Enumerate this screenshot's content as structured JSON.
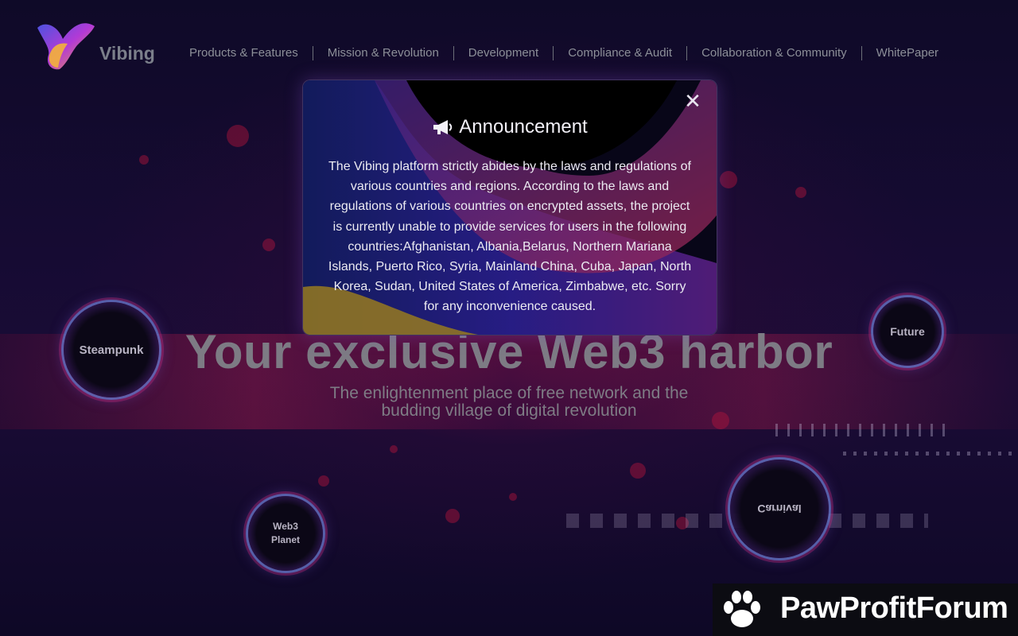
{
  "brand": {
    "name": "Vibing",
    "accent": "#7c3aed"
  },
  "nav": {
    "items": [
      {
        "label": "Products & Features"
      },
      {
        "label": "Mission & Revolution"
      },
      {
        "label": "Development"
      },
      {
        "label": "Compliance & Audit"
      },
      {
        "label": "Collaboration & Community"
      },
      {
        "label": "WhitePaper"
      }
    ]
  },
  "hero": {
    "title": "Your exclusive Web3 harbor",
    "subtitle": "The enlightenment place of free network and the budding village of digital revolution"
  },
  "orbs": [
    {
      "label": "Steampunk"
    },
    {
      "label": "Future"
    },
    {
      "label": "Web3\nPlanet"
    },
    {
      "label": "Carnival"
    }
  ],
  "modal": {
    "title": "Announcement",
    "icon": "megaphone-icon",
    "close_icon": "close-icon",
    "body": "The Vibing platform strictly abides by the laws and regulations of various countries and regions. According to the laws and regulations of various countries on encrypted assets, the project is currently unable to provide services for users in the following countries:Afghanistan, Albania,Belarus, Northern Mariana Islands, Puerto Rico, Syria, Mainland China, Cuba, Japan, North Korea, Sudan, United States of America, Zimbabwe, etc. Sorry for any inconvenience caused."
  },
  "watermark": {
    "text": "PawProfitForum",
    "icon": "paw-icon"
  }
}
